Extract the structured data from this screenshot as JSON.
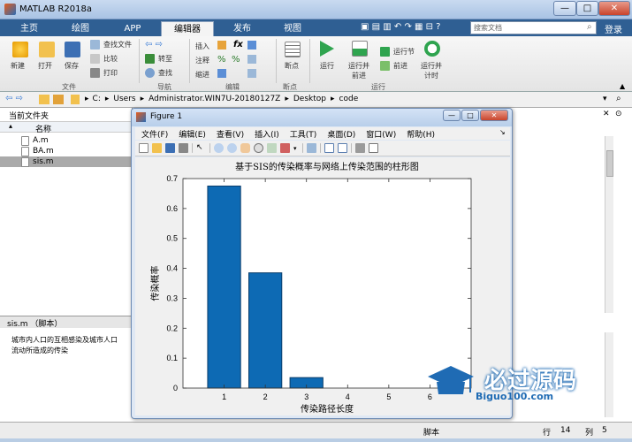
{
  "window": {
    "title": "MATLAB R2018a",
    "min": "—",
    "max": "□",
    "close": "✕"
  },
  "tabs": [
    {
      "label": "主页"
    },
    {
      "label": "绘图"
    },
    {
      "label": "APP"
    },
    {
      "label": "编辑器"
    },
    {
      "label": "发布"
    },
    {
      "label": "视图"
    }
  ],
  "search": {
    "placeholder": "搜索文档"
  },
  "login": "登录",
  "ribbon": {
    "file": {
      "new": "新建",
      "open": "打开",
      "save": "保存",
      "find_files": "查找文件",
      "compare": "比较",
      "print": "打印",
      "group": "文件"
    },
    "nav": {
      "goto": "转至",
      "find": "查找",
      "group": "导航"
    },
    "edit": {
      "insert": "插入",
      "comment": "注释",
      "indent": "缩进",
      "fx": "fx",
      "group": "编辑"
    },
    "breakpoints": {
      "label": "断点",
      "group": "断点"
    },
    "run": {
      "run": "运行",
      "run_advance": "运行并\n前进",
      "run_section": "运行节",
      "advance": "前进",
      "run_time": "运行并\n计时",
      "group": "运行"
    }
  },
  "address": {
    "parts": [
      "C:",
      "Users",
      "Administrator.WIN7U-20180127Z",
      "Desktop",
      "code"
    ]
  },
  "current_folder": {
    "title": "当前文件夹",
    "col_name": "名称",
    "files": [
      {
        "name": "A.m"
      },
      {
        "name": "BA.m"
      },
      {
        "name": "sis.m"
      }
    ]
  },
  "details": {
    "header": "sis.m （脚本）",
    "text_line1": "城市内人口的互相感染及城市人口",
    "text_line2": "流动所造成的传染"
  },
  "status": {
    "script": "脚本",
    "row_label": "行",
    "row": "14",
    "col_label": "列",
    "col": "5"
  },
  "figure": {
    "title": "Figure 1",
    "menus": [
      "文件(F)",
      "编辑(E)",
      "查看(V)",
      "插入(I)",
      "工具(T)",
      "桌面(D)",
      "窗口(W)",
      "帮助(H)"
    ]
  },
  "watermark": {
    "name": "必过源码",
    "url": "Biguo100.com"
  },
  "colors": {
    "bar": "#0d6ab4",
    "tabstrip": "#2f5f93"
  },
  "chart_data": {
    "type": "bar",
    "title": "基于SIS的传染概率与网络上传染范围的柱形图",
    "xlabel": "传染路径长度",
    "ylabel": "传染概率",
    "categories": [
      1,
      2,
      3,
      4,
      5,
      6
    ],
    "values": [
      0.675,
      0.385,
      0.035,
      0,
      0,
      0
    ],
    "xlim": [
      0,
      7
    ],
    "ylim": [
      0,
      0.7
    ],
    "yticks": [
      0,
      0.1,
      0.2,
      0.3,
      0.4,
      0.5,
      0.6,
      0.7
    ],
    "xticks": [
      1,
      2,
      3,
      4,
      5,
      6
    ],
    "grid": false
  }
}
